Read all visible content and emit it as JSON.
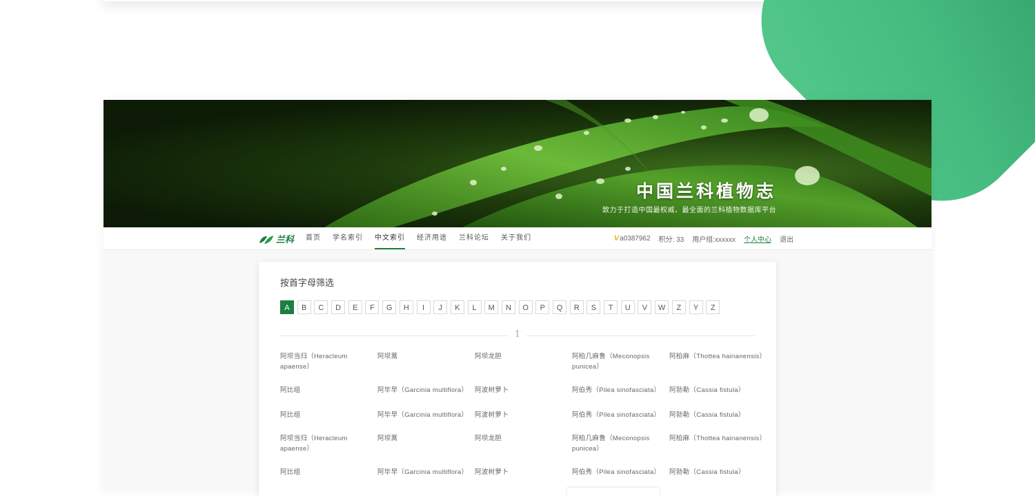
{
  "banner": {
    "title": "中国兰科植物志",
    "subtitle": "致力于打造中国最权威、最全面的兰科植物数据库平台"
  },
  "nav": {
    "logo_text": "兰科",
    "items": [
      "首页",
      "学名索引",
      "中文索引",
      "经济用途",
      "兰科论坛",
      "关于我们"
    ],
    "active_index": 2
  },
  "user": {
    "username": "a0387962",
    "points": "积分: 33",
    "group": "用户组:xxxxxx",
    "center": "个人中心",
    "logout": "退出"
  },
  "filter": {
    "title": "按首字母筛选",
    "letters": [
      "A",
      "B",
      "C",
      "D",
      "E",
      "F",
      "G",
      "H",
      "I",
      "J",
      "K",
      "L",
      "M",
      "N",
      "O",
      "P",
      "Q",
      "R",
      "S",
      "T",
      "U",
      "V",
      "W",
      "Z",
      "Y",
      "Z"
    ],
    "active_letter": "A",
    "page_number": "1"
  },
  "rows": [
    [
      "阿坝当归（Heracleum apaense）",
      "阿坝蒿",
      "阿坝龙胆",
      "阿柏几麻鲁（Meconopsis punicea）",
      "阿柏麻（Thottea hainanensis）"
    ],
    [
      "阿比组",
      "阿毕早（Garcinia multiflora）",
      "阿波树萝卜",
      "阿伯秀（Pilea sinofasciata）",
      "阿勃勒（Cassia fistula）"
    ],
    [
      "阿比组",
      "阿毕早（Garcinia multiflora）",
      "阿波树萝卜",
      "阿伯秀（Pilea sinofasciata）",
      "阿勃勒（Cassia fistula）"
    ],
    [
      "阿坝当归（Heracleum apaense）",
      "阿坝蒿",
      "阿坝龙胆",
      "阿柏几麻鲁（Meconopsis punicea）",
      "阿柏麻（Thottea hainanensis）"
    ],
    [
      "阿比组",
      "阿毕早（Garcinia multiflora）",
      "阿波树萝卜",
      "阿伯秀（Pilea sinofasciata）",
      "阿勃勒（Cassia fistula）"
    ]
  ],
  "colors": {
    "accent": "#1d7f3e",
    "decor_green": "#45bb80"
  }
}
